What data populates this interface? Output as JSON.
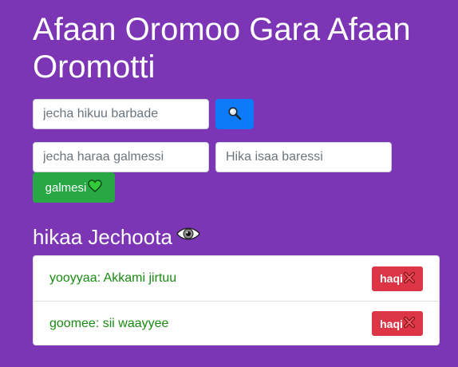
{
  "header": {
    "title": "Afaan Oromoo Gara Afaan Oromotti"
  },
  "search": {
    "placeholder": "jecha hikuu barbade",
    "value": "",
    "icon": "magnifier-icon"
  },
  "add_form": {
    "word_placeholder": "jecha haraa galmessi",
    "meaning_placeholder": "Hika isaa baressi",
    "submit_label": "galmesi",
    "submit_icon": "green-heart-icon"
  },
  "list": {
    "heading": "hikaa Jechoota",
    "heading_icon": "eye-icon",
    "items": [
      {
        "text": "yooyyaa: Akkami jirtuu",
        "delete_label": "haqi"
      },
      {
        "text": "goomee: sii waayyee",
        "delete_label": "haqi"
      }
    ]
  },
  "colors": {
    "background": "#7b35b5",
    "search_button": "#0d7bf9",
    "add_button": "#28a745",
    "delete_button": "#dc3545",
    "item_text": "#198b12"
  }
}
